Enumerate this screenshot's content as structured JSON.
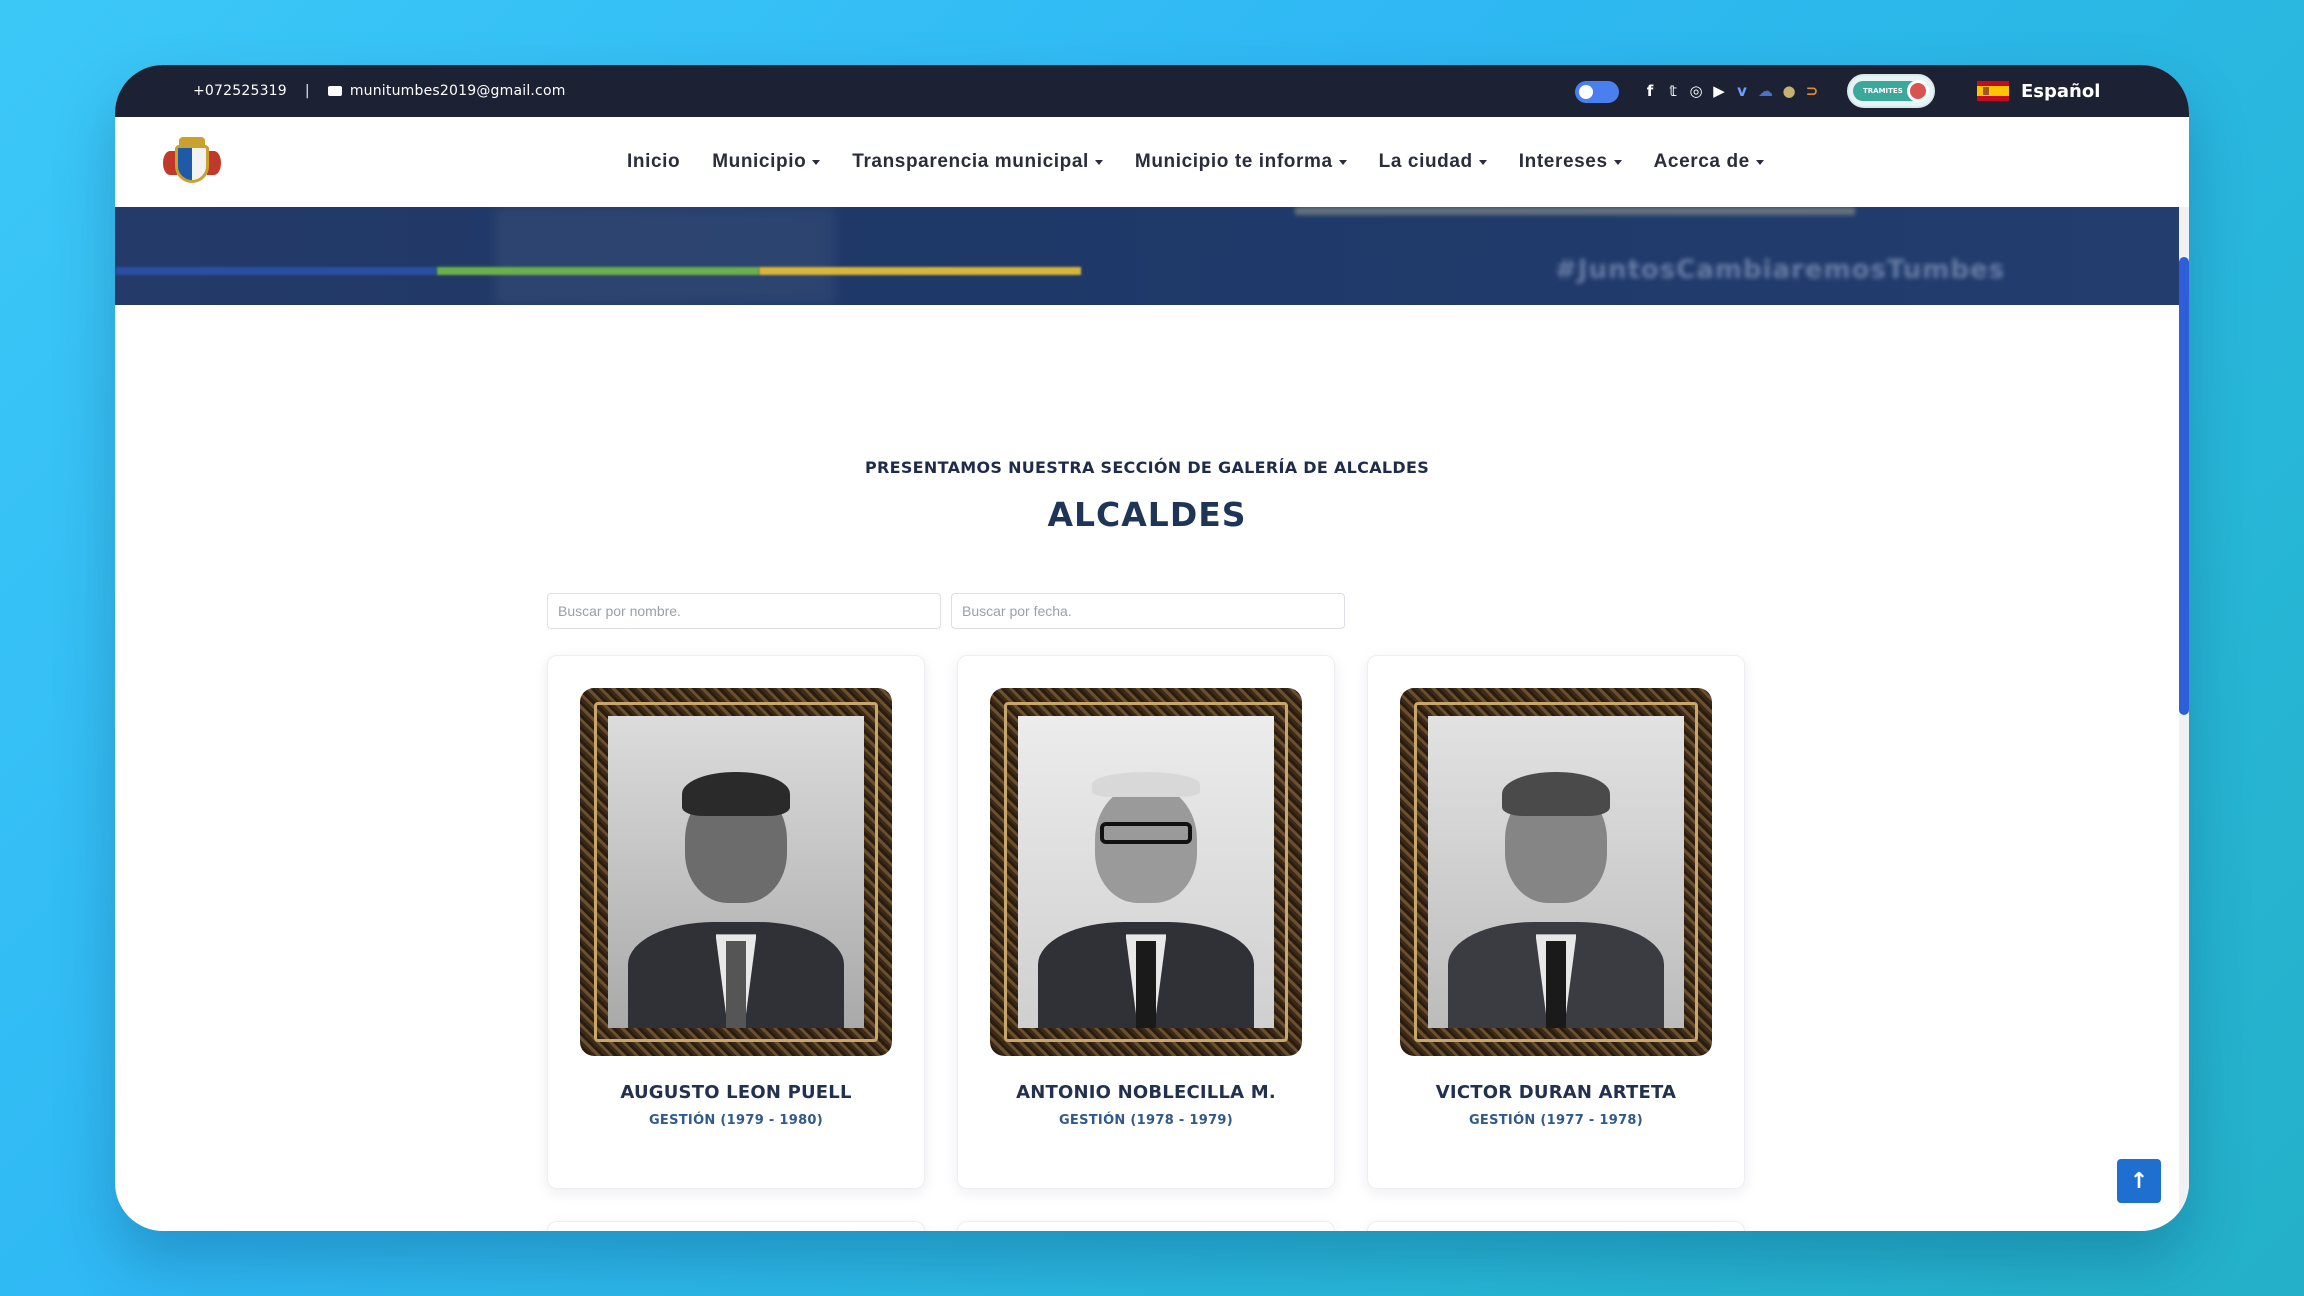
{
  "topbar": {
    "phone": "+072525319",
    "separator": "|",
    "email": "munitumbes2019@gmail.com",
    "social_icons": [
      "facebook-icon",
      "twitter-icon",
      "instagram-icon",
      "youtube-icon",
      "vimeo-icon",
      "cloud-icon",
      "seal-icon",
      "link-icon"
    ],
    "tramites_label": "TRAMITES",
    "language": "Español"
  },
  "nav": {
    "items": [
      {
        "label": "Inicio",
        "dropdown": false
      },
      {
        "label": "Municipio",
        "dropdown": true
      },
      {
        "label": "Transparencia municipal",
        "dropdown": true
      },
      {
        "label": "Municipio te informa",
        "dropdown": true
      },
      {
        "label": "La ciudad",
        "dropdown": true
      },
      {
        "label": "Intereses",
        "dropdown": true
      },
      {
        "label": "Acerca de",
        "dropdown": true
      }
    ]
  },
  "banner": {
    "hashtag": "#JuntosCambiaremosTumbes"
  },
  "gallery": {
    "subtitle": "PRESENTAMOS NUESTRA SECCIÓN DE GALERÍA DE ALCALDES",
    "title": "ALCALDES",
    "search_name_placeholder": "Buscar por nombre.",
    "search_date_placeholder": "Buscar por fecha.",
    "mayors": [
      {
        "name": "AUGUSTO LEON PUELL",
        "period": "GESTIÓN (1979 - 1980)"
      },
      {
        "name": "ANTONIO NOBLECILLA M.",
        "period": "GESTIÓN (1978 - 1979)"
      },
      {
        "name": "VICTOR DURAN ARTETA",
        "period": "GESTIÓN (1977 - 1978)"
      }
    ]
  },
  "colors": {
    "topbar_bg": "#1c2133",
    "heading": "#1f3557",
    "accent": "#1f6fd1"
  }
}
